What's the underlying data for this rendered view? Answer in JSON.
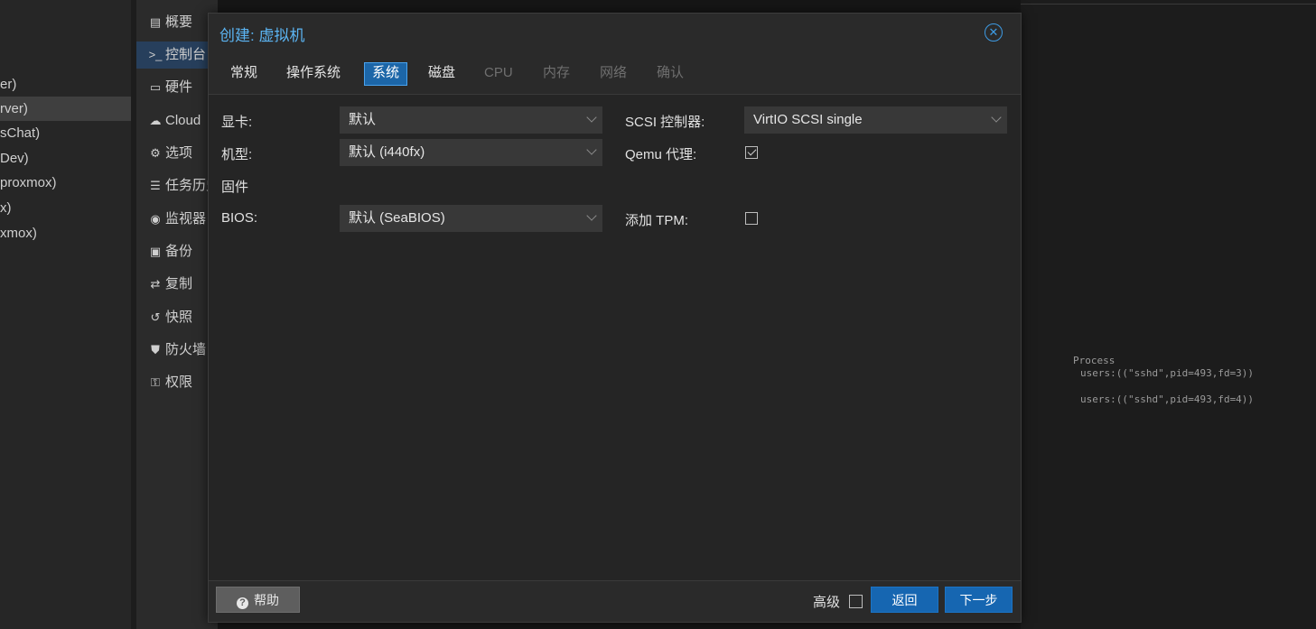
{
  "tree": {
    "items": [
      {
        "label": "er)"
      },
      {
        "label": "rver)"
      },
      {
        "label": "sChat)"
      },
      {
        "label": "Dev)"
      },
      {
        "label": "proxmox)"
      },
      {
        "label": "x)"
      },
      {
        "label": "xmox)"
      }
    ]
  },
  "vmnav": {
    "items": [
      {
        "icon": "book-icon",
        "glyph": "▤",
        "label": "概要"
      },
      {
        "icon": "terminal-icon",
        "glyph": ">_",
        "label": "控制台"
      },
      {
        "icon": "monitor-icon",
        "glyph": "▭",
        "label": "硬件"
      },
      {
        "icon": "cloud-icon",
        "glyph": "☁",
        "label": "Cloud"
      },
      {
        "icon": "gear-icon",
        "glyph": "⚙",
        "label": "选项"
      },
      {
        "icon": "list-icon",
        "glyph": "☰",
        "label": "任务历史"
      },
      {
        "icon": "eye-icon",
        "glyph": "◉",
        "label": "监视器"
      },
      {
        "icon": "floppy-icon",
        "glyph": "▣",
        "label": "备份"
      },
      {
        "icon": "retweet-icon",
        "glyph": "⇄",
        "label": "复制"
      },
      {
        "icon": "history-icon",
        "glyph": "↺",
        "label": "快照"
      },
      {
        "icon": "shield-icon",
        "glyph": "⛊",
        "label": "防火墙"
      },
      {
        "icon": "unlock-icon",
        "glyph": "⚿",
        "label": "权限"
      }
    ]
  },
  "console": {
    "line1": "Process",
    "line2": "users:((\"sshd\",pid=493,fd=3))",
    "line3": "users:((\"sshd\",pid=493,fd=4))"
  },
  "dialog": {
    "title": "创建: 虚拟机",
    "close_icon": "close-circle-icon",
    "tabs": [
      {
        "label": "常规",
        "state": "normal"
      },
      {
        "label": "操作系统",
        "state": "normal"
      },
      {
        "label": "系统",
        "state": "active"
      },
      {
        "label": "磁盘",
        "state": "normal"
      },
      {
        "label": "CPU",
        "state": "disabled"
      },
      {
        "label": "内存",
        "state": "disabled"
      },
      {
        "label": "网络",
        "state": "disabled"
      },
      {
        "label": "确认",
        "state": "disabled"
      }
    ],
    "form": {
      "graphics_label": "显卡:",
      "graphics_value": "默认",
      "machine_label": "机型:",
      "machine_value": "默认 (i440fx)",
      "firmware_heading": "固件",
      "bios_label": "BIOS:",
      "bios_value": "默认 (SeaBIOS)",
      "scsi_label": "SCSI 控制器:",
      "scsi_value": "VirtIO SCSI single",
      "qemu_agent_label": "Qemu 代理:",
      "qemu_agent_checked": true,
      "tpm_label": "添加 TPM:",
      "tpm_checked": false
    },
    "footer": {
      "help_label": "帮助",
      "advanced_label": "高级",
      "advanced_checked": false,
      "back_label": "返回",
      "next_label": "下一步"
    }
  },
  "colors": {
    "accent": "#1666b1",
    "title": "#5bb4f2",
    "background": "#1d1d1d"
  }
}
